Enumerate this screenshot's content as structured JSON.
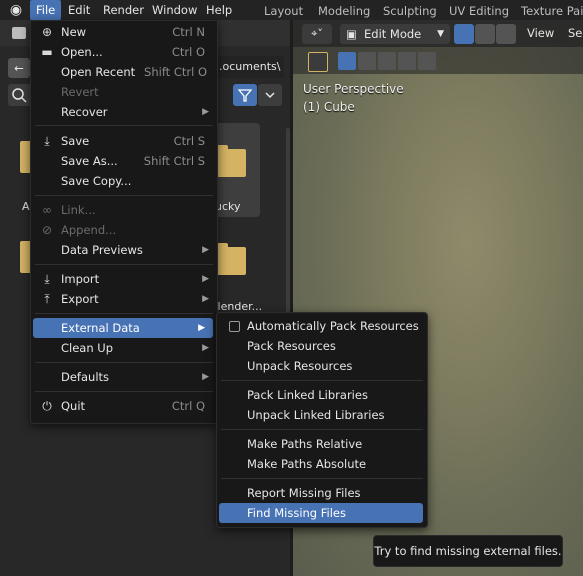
{
  "menubar": {
    "items": [
      "File",
      "Edit",
      "Render",
      "Window",
      "Help"
    ],
    "workspaces": [
      "Layout",
      "Modeling",
      "Sculpting",
      "UV Editing",
      "Texture Pain"
    ]
  },
  "file_browser": {
    "path": "...ocuments\\",
    "tiles": [
      {
        "label": "A"
      },
      {
        "label": "ucky"
      },
      {
        "label": ""
      },
      {
        "label": "Blender..."
      }
    ]
  },
  "viewport": {
    "mode": "Edit Mode",
    "view_label": "View",
    "sel_label": "Sel",
    "perspective": "User Perspective",
    "object": "(1) Cube"
  },
  "file_menu": {
    "items": [
      {
        "label": "New",
        "shortcut": "Ctrl N",
        "icon": "new-file-icon"
      },
      {
        "label": "Open...",
        "shortcut": "Ctrl O",
        "icon": "folder-icon"
      },
      {
        "label": "Open Recent",
        "shortcut": "Shift Ctrl O"
      },
      {
        "label": "Revert",
        "disabled": true
      },
      {
        "label": "Recover"
      },
      {
        "label": "Save",
        "shortcut": "Ctrl S",
        "icon": "save-icon"
      },
      {
        "label": "Save As...",
        "shortcut": "Shift Ctrl S"
      },
      {
        "label": "Save Copy..."
      },
      {
        "label": "Link...",
        "disabled": true,
        "icon": "link-icon"
      },
      {
        "label": "Append...",
        "disabled": true,
        "icon": "append-icon"
      },
      {
        "label": "Data Previews"
      },
      {
        "label": "Import",
        "icon": "import-icon"
      },
      {
        "label": "Export",
        "icon": "export-icon"
      },
      {
        "label": "External Data"
      },
      {
        "label": "Clean Up"
      },
      {
        "label": "Defaults"
      },
      {
        "label": "Quit",
        "shortcut": "Ctrl Q",
        "icon": "power-icon"
      }
    ]
  },
  "external_data_menu": {
    "items": [
      {
        "label": "Automatically Pack Resources",
        "checkbox": true
      },
      {
        "label": "Pack Resources"
      },
      {
        "label": "Unpack Resources"
      },
      {
        "label": "Pack Linked Libraries"
      },
      {
        "label": "Unpack Linked Libraries"
      },
      {
        "label": "Make Paths Relative"
      },
      {
        "label": "Make Paths Absolute"
      },
      {
        "label": "Report Missing Files"
      },
      {
        "label": "Find Missing Files"
      }
    ]
  },
  "tooltip": {
    "text": "Try to find missing external files."
  },
  "colors": {
    "accent": "#4772b3",
    "menu_bg": "#181818",
    "folder": "#d4b363"
  }
}
